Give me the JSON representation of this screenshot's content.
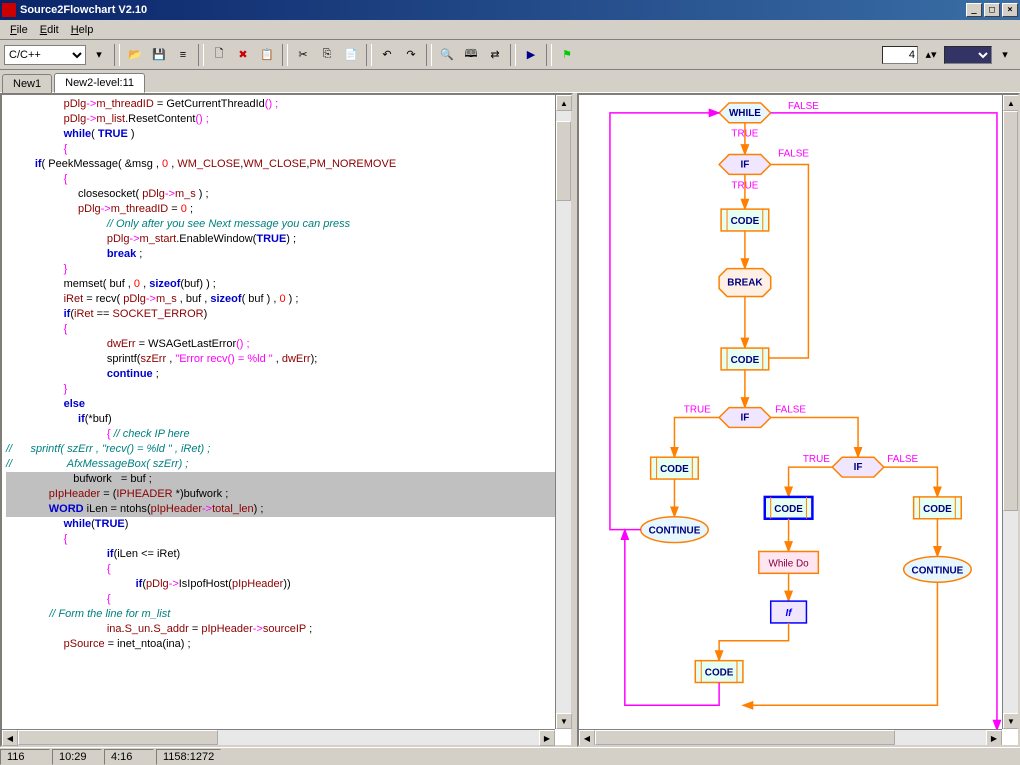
{
  "window": {
    "title": "Source2Flowchart V2.10"
  },
  "menu": {
    "file": "File",
    "edit": "Edit",
    "help": "Help"
  },
  "toolbar": {
    "lang": "C/C++",
    "num": "4"
  },
  "tabs": {
    "t1": "New1",
    "t2": "New2-level:11"
  },
  "code": {
    "l01a": "pDlg",
    "l01b": "->",
    "l01c": "m_threadID",
    "l01d": " = ",
    "l01e": "GetCurrentThreadId",
    "l01f": "() ;",
    "l02a": "pDlg",
    "l02b": "->",
    "l02c": "m_list",
    "l02d": ".",
    "l02e": "ResetContent",
    "l02f": "() ;",
    "l03a": "while",
    "l03b": "( ",
    "l03c": "TRUE",
    "l03d": " )",
    "l04a": "{",
    "l05a": "if",
    "l05b": "( ",
    "l05c": "PeekMessage",
    "l05d": "( &msg , ",
    "l05e": "0",
    "l05f": " , ",
    "l05g": "WM_CLOSE",
    "l05h": ",",
    "l05i": "WM_CLOSE",
    "l05j": ",",
    "l05k": "PM_NOREMOVE",
    "l06a": "{",
    "l07a": "closesocket",
    "l07b": "( ",
    "l07c": "pDlg",
    "l07d": "->",
    "l07e": "m_s",
    "l07f": " ) ;",
    "l08a": "pDlg",
    "l08b": "->",
    "l08c": "m_threadID",
    "l08d": " = ",
    "l08e": "0",
    "l08f": " ;",
    "l09a": "// Only after you see Next message you can press",
    "l10a": "pDlg",
    "l10b": "->",
    "l10c": "m_start",
    "l10d": ".",
    "l10e": "EnableWindow",
    "l10f": "(",
    "l10g": "TRUE",
    "l10h": ") ;",
    "l11a": "break",
    "l11b": " ;",
    "l12a": "}",
    "l13a": "memset",
    "l13b": "( buf , ",
    "l13c": "0",
    "l13d": " , ",
    "l13e": "sizeof",
    "l13f": "(buf) ) ;",
    "l14a": "iRet",
    "l14b": " = ",
    "l14c": "recv",
    "l14d": "( ",
    "l14e": "pDlg",
    "l14f": "->",
    "l14g": "m_s",
    "l14h": " , buf , ",
    "l14i": "sizeof",
    "l14j": "( buf ) , ",
    "l14k": "0",
    "l14l": " ) ;",
    "l15a": "if",
    "l15b": "(",
    "l15c": "iRet",
    "l15d": " == ",
    "l15e": "SOCKET_ERROR",
    "l15f": ")",
    "l16a": "{",
    "l17a": "dwErr",
    "l17b": " = ",
    "l17c": "WSAGetLastError",
    "l17d": "() ;",
    "l18a": "sprintf",
    "l18b": "(",
    "l18c": "szErr",
    "l18d": " , ",
    "l18e": "\"Error recv() = %ld \"",
    "l18f": " , ",
    "l18g": "dwErr",
    "l18h": ");",
    "l19a": "continue",
    "l19b": " ;",
    "l20a": "}",
    "l21a": "else",
    "l22a": "if",
    "l22b": "(*buf)",
    "l23a": "{ ",
    "l23b": "// check IP here",
    "l24a": "//",
    "l24b": "      sprintf( szErr , \"recv() = %ld \" , iRet) ;",
    "l25a": "//",
    "l25b": "                  AfxMessageBox( szErr) ;",
    "l26a": "bufwork   = buf ;",
    "l27a": "pIpHeader",
    "l27b": " = (",
    "l27c": "IPHEADER",
    "l27d": " *)bufwork ;",
    "l28a": "WORD",
    "l28b": " iLen = ",
    "l28c": "ntohs",
    "l28d": "(",
    "l28e": "pIpHeader",
    "l28f": "->",
    "l28g": "total_len",
    "l28h": ") ;",
    "l29a": "while",
    "l29b": "(",
    "l29c": "TRUE",
    "l29d": ")",
    "l30a": "{",
    "l31a": "if",
    "l31b": "(iLen <= iRet)",
    "l32a": "{",
    "l33a": "if",
    "l33b": "(",
    "l33c": "pDlg",
    "l33d": "->",
    "l33e": "IsIpofHost",
    "l33f": "(",
    "l33g": "pIpHeader",
    "l33h": "))",
    "l34a": "{",
    "l35a": "// Form the line for m_list",
    "l36a": "ina",
    "l36b": ".",
    "l36c": "S_un",
    "l36d": ".",
    "l36e": "S_addr",
    "l36f": " = ",
    "l36g": "pIpHeader",
    "l36h": "->",
    "l36i": "sourceIP",
    "l36j": " ;",
    "l37a": "pSource",
    "l37b": " = ",
    "l37c": "inet_ntoa",
    "l37d": "(ina) ;"
  },
  "flow": {
    "while": "WHILE",
    "if": "IF",
    "code": "CODE",
    "break": "BREAK",
    "continue": "CONTINUE",
    "whiledo": "While Do",
    "ifnode": "If",
    "true": "TRUE",
    "false": "FALSE"
  },
  "status": {
    "s1": "116",
    "s2": "10:29",
    "s3": "4:16",
    "s4": "1158:1272"
  }
}
